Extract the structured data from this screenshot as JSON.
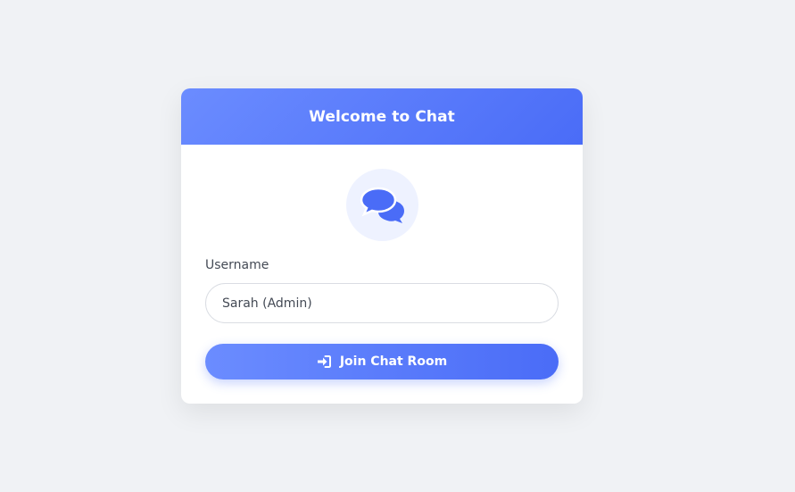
{
  "card": {
    "title": "Welcome to Chat",
    "icon": "chat-bubbles-icon"
  },
  "form": {
    "username_label": "Username",
    "username_value": "Sarah (Admin)",
    "join_label": "Join Chat Room",
    "join_icon": "sign-in-icon"
  },
  "colors": {
    "accent_start": "#6b8cff",
    "accent_end": "#4a6cf7",
    "background": "#f0f2f5",
    "icon_bg": "#eef2ff"
  }
}
